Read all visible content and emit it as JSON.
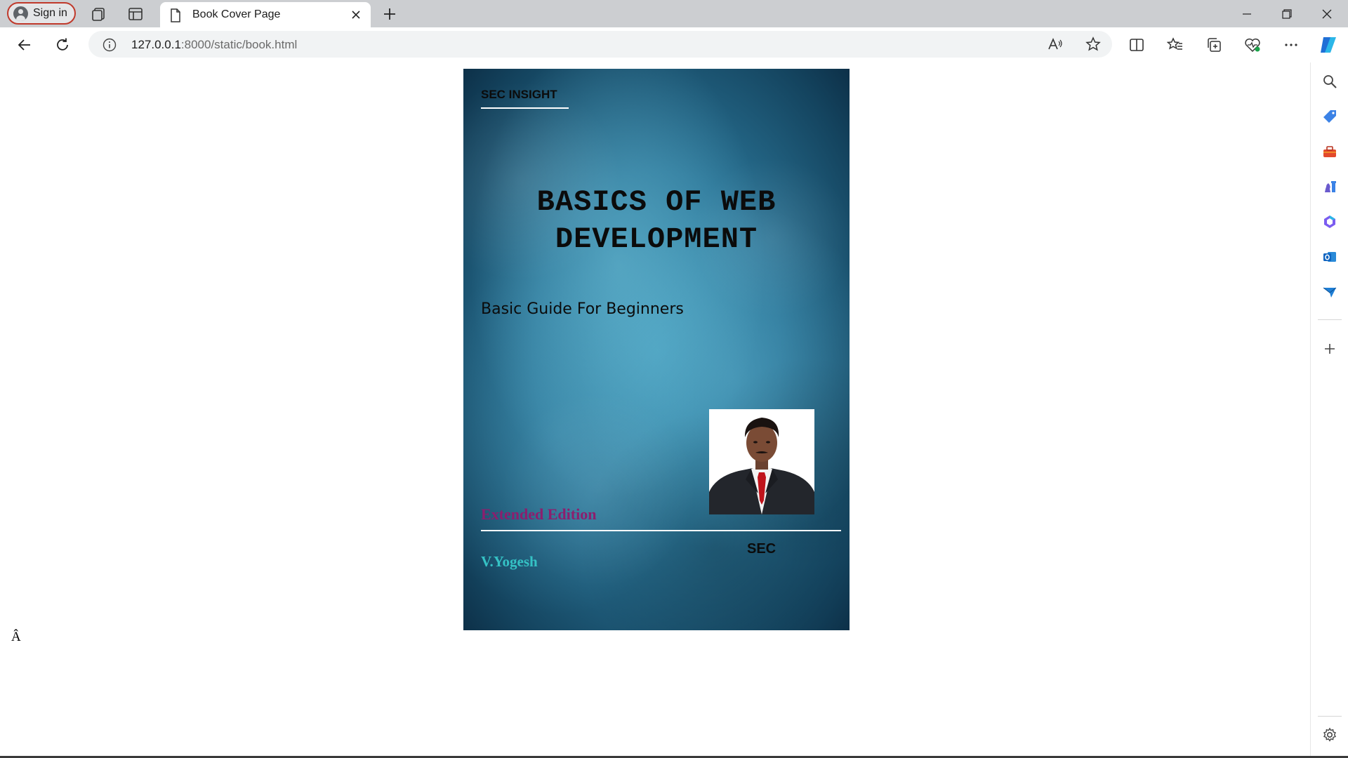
{
  "browser": {
    "signin_label": "Sign in",
    "tab": {
      "title": "Book Cover Page"
    },
    "address": {
      "host": "127.0.0.1",
      "path": ":8000/static/book.html"
    }
  },
  "page": {
    "stray_char": "Â",
    "cover": {
      "publisher": "SEC INSIGHT",
      "title_line1": "BASICS OF WEB",
      "title_line2": "DEVELOPMENT",
      "subtitle": "Basic Guide For Beginners",
      "edition": "Extended Edition",
      "author": "V.Yogesh",
      "imprint": "SEC",
      "colors": {
        "edition": "#8c1e6e",
        "author": "#35c2c5",
        "background": "#2a7496"
      }
    }
  },
  "sidebar": {
    "icons": [
      "search-icon",
      "tag-icon",
      "toolbox-icon",
      "chess-icon",
      "copilot-icon",
      "outlook-icon",
      "send-icon",
      "add-icon",
      "settings-icon"
    ]
  }
}
